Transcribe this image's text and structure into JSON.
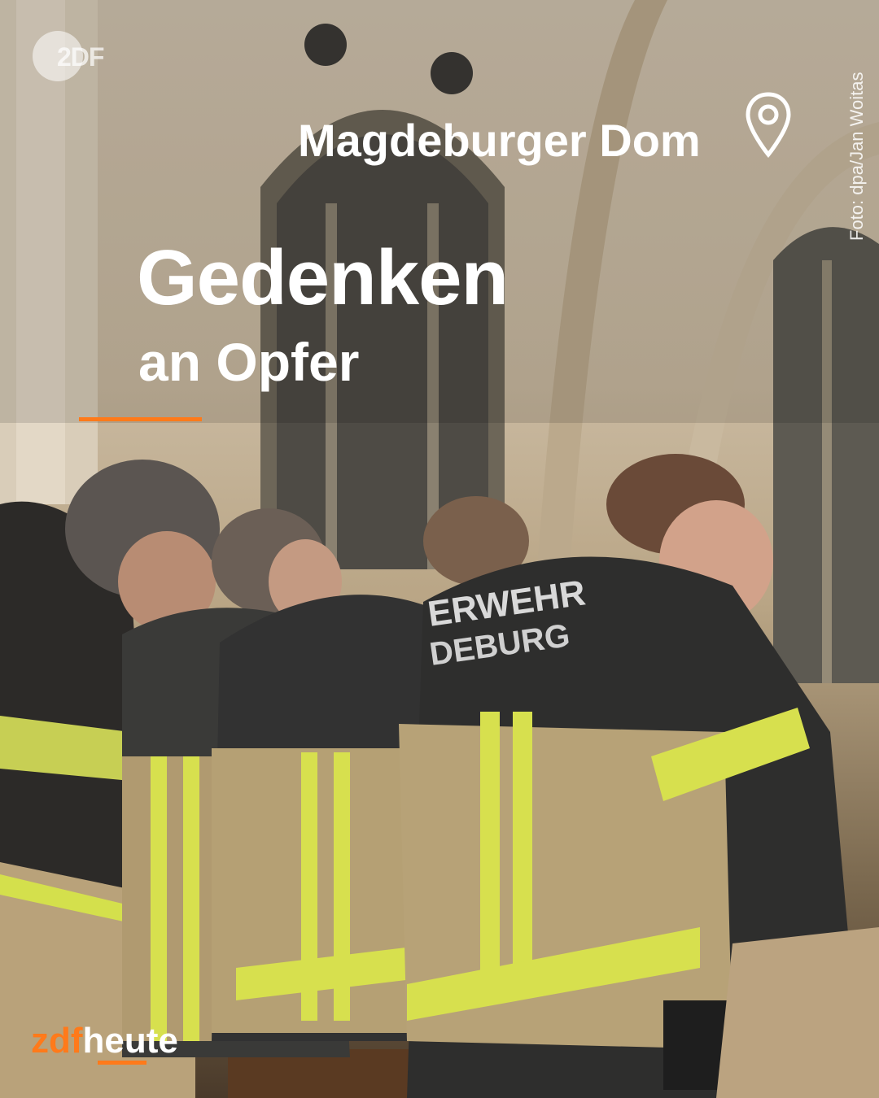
{
  "badge": {
    "label": "2DF",
    "icon": "zdf-logo-icon"
  },
  "location": {
    "text": "Magdeburger Dom",
    "icon": "location-pin-icon"
  },
  "credit": "Foto: dpa/Jan Woitas",
  "headline": "Gedenken",
  "subline": "an Opfer",
  "photo": {
    "jacket_text_1": "ERWEHR",
    "jacket_text_2": "DEBURG"
  },
  "brand": {
    "part1": "zdf",
    "part2": "heute"
  },
  "colors": {
    "accent": "#ff7a1a",
    "text": "#ffffff"
  }
}
